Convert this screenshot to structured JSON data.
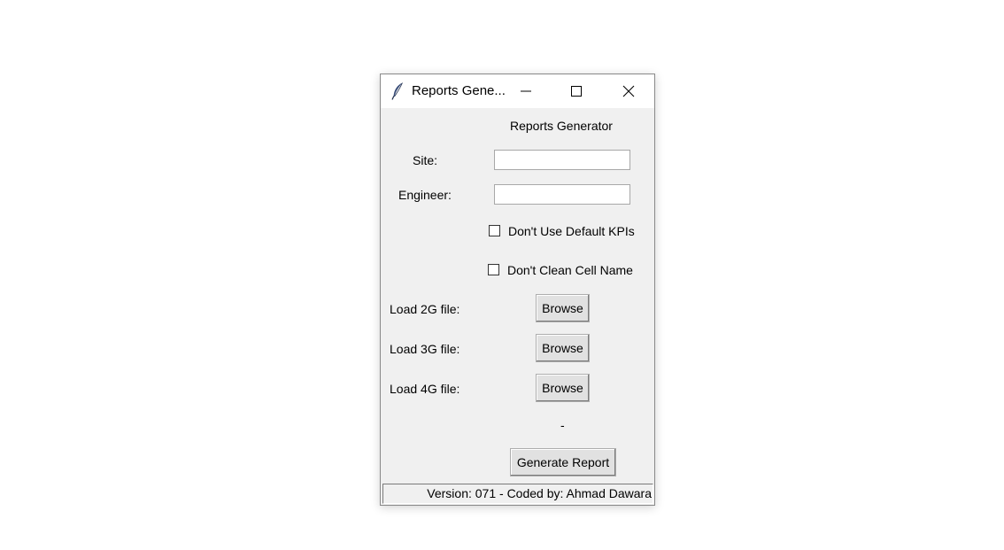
{
  "window": {
    "title": "Reports Gene...",
    "icon": "feather-icon"
  },
  "header": {
    "heading": "Reports Generator"
  },
  "form": {
    "site_label": "Site:",
    "site_value": "",
    "engineer_label": "Engineer:",
    "engineer_value": "",
    "checkbox_default_kpis_label": "Don't Use Default KPIs",
    "checkbox_default_kpis_checked": false,
    "checkbox_clean_cell_label": "Don't Clean Cell Name",
    "checkbox_clean_cell_checked": false,
    "load_2g_label": "Load 2G file:",
    "load_3g_label": "Load 3G file:",
    "load_4g_label": "Load 4G file:",
    "browse_label": "Browse",
    "status_text": "-",
    "generate_label": "Generate Report"
  },
  "statusbar": {
    "text": "Version: 071 - Coded by: Ahmad Dawara"
  }
}
